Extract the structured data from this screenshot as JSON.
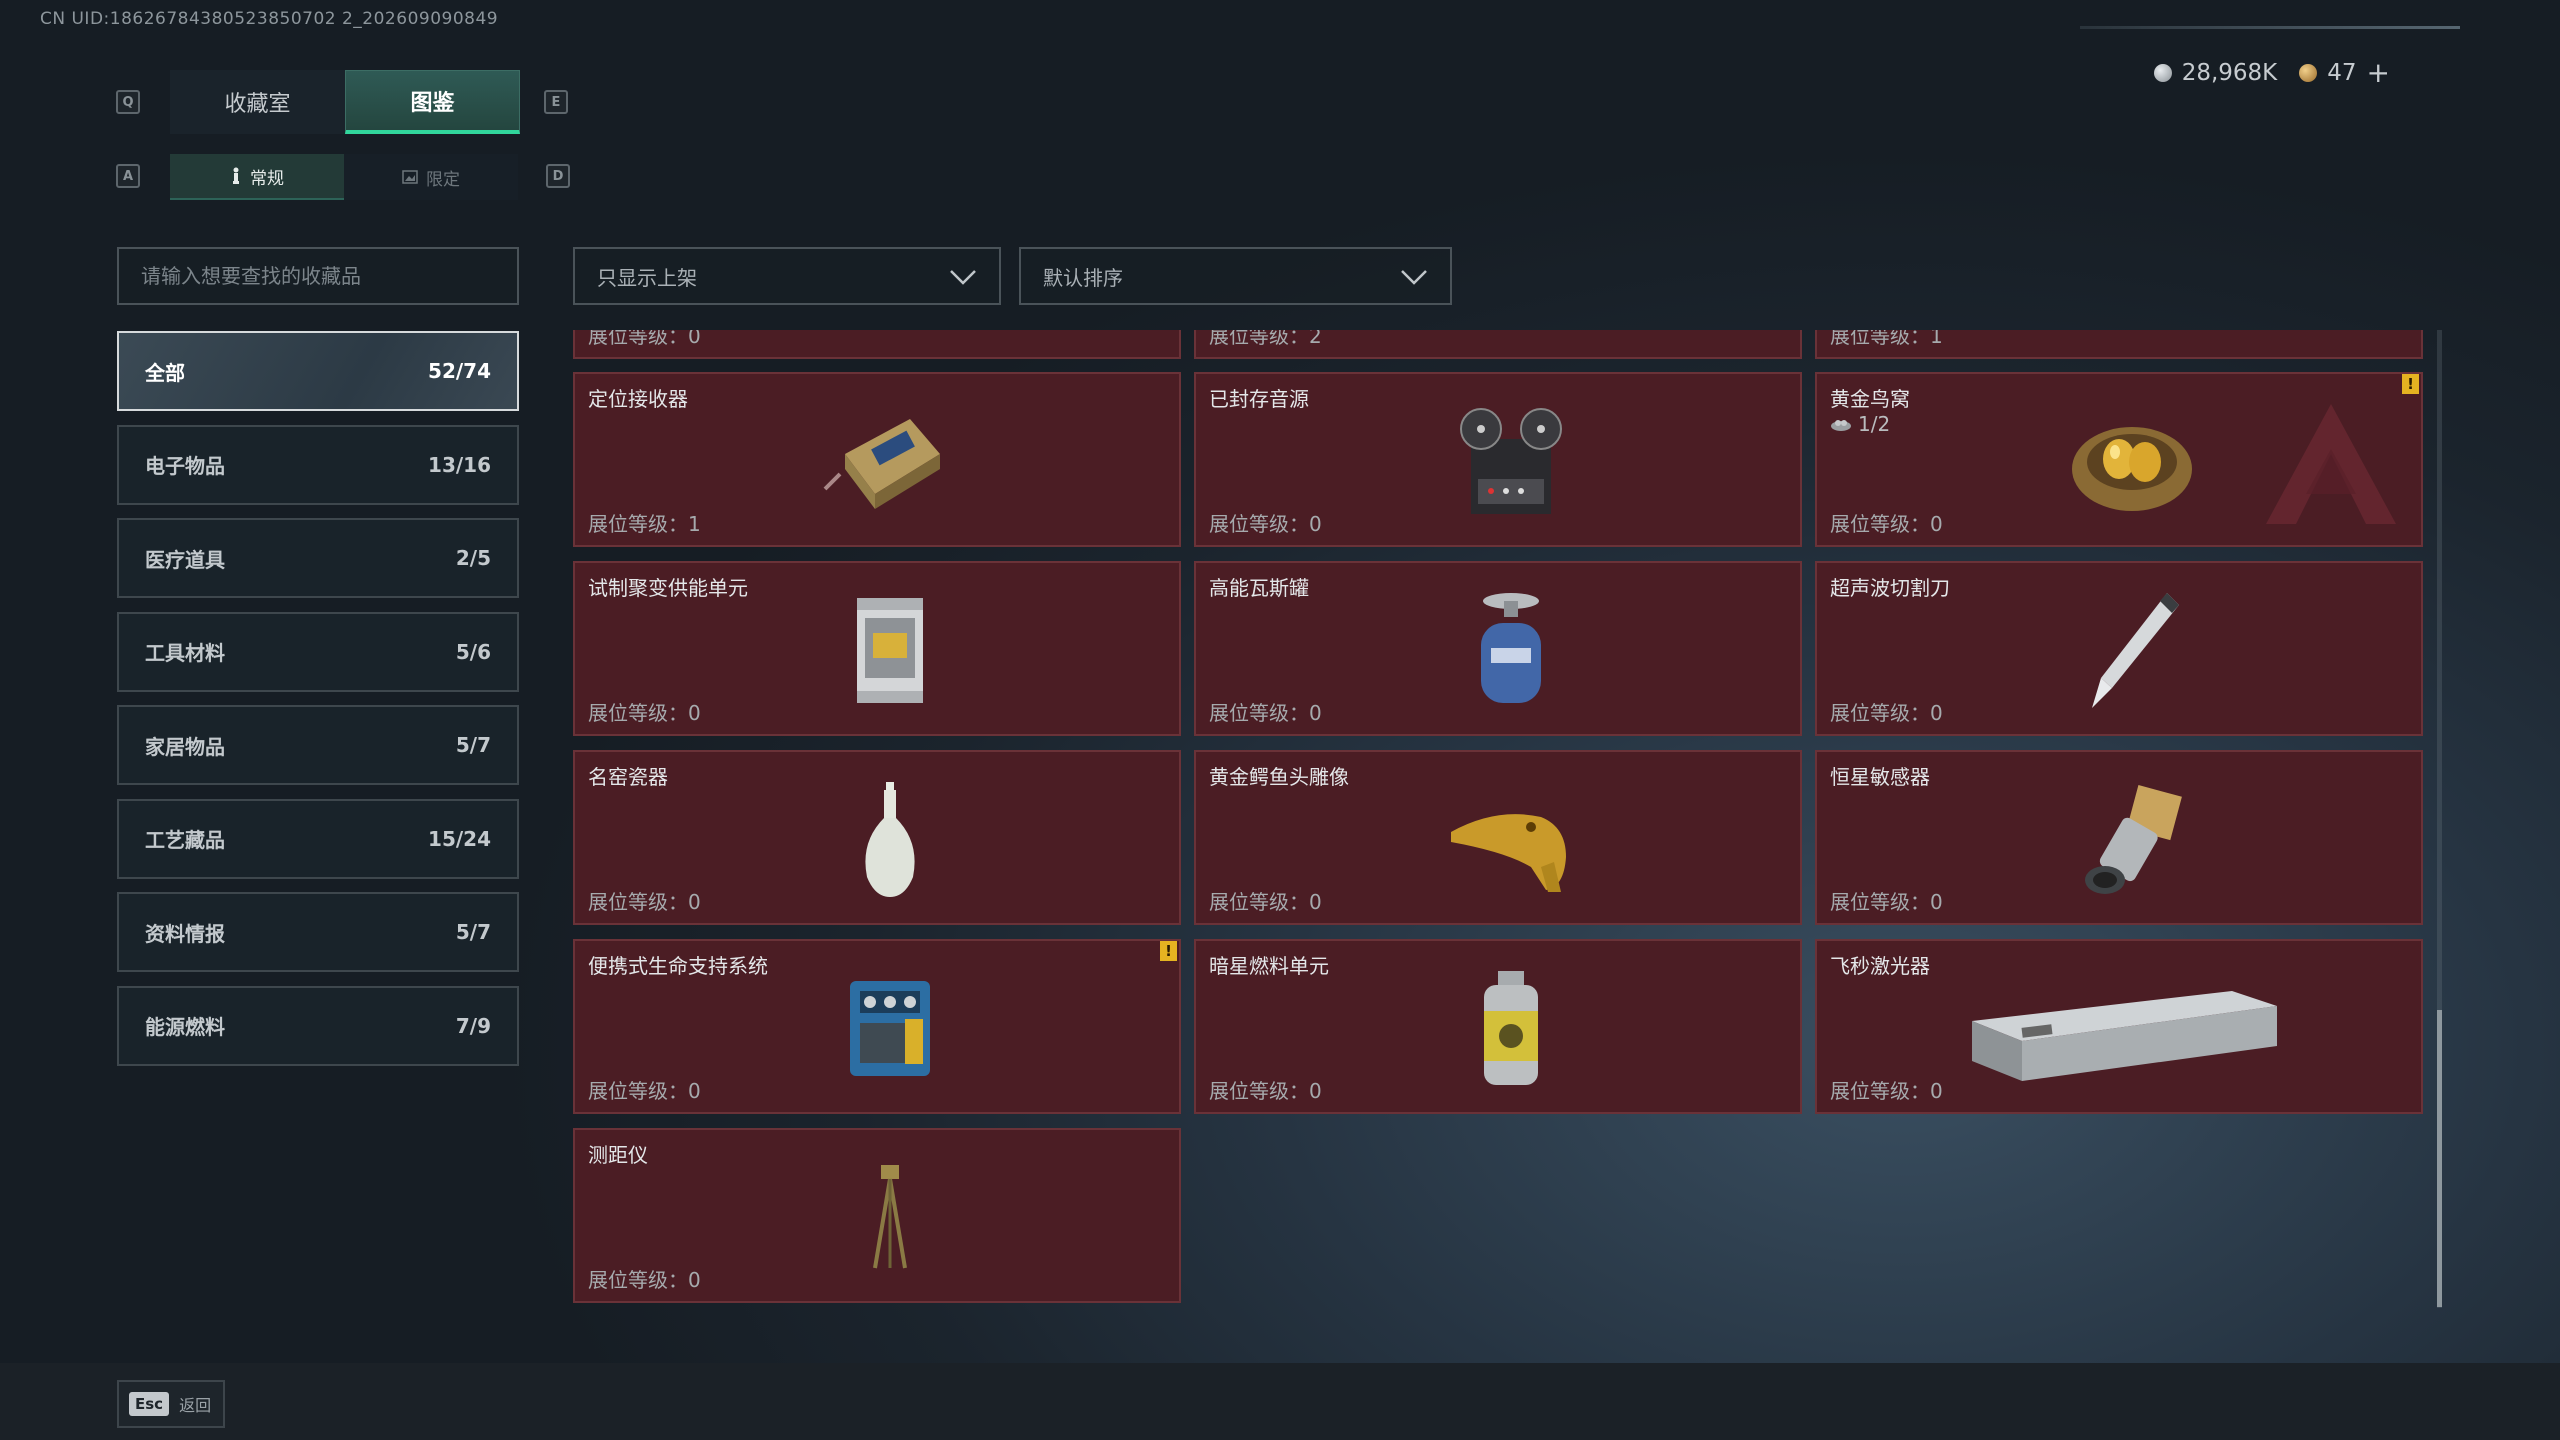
{
  "uid": "CN UID:18626784380523850702 2_202609090849",
  "currency": {
    "silver": "28,968K",
    "gold": "47",
    "plus": "+"
  },
  "keys": {
    "prev_tab": "Q",
    "next_tab": "E",
    "prev_subtab": "A",
    "next_subtab": "D"
  },
  "tabs": [
    {
      "label": "收藏室",
      "active": false
    },
    {
      "label": "图鉴",
      "active": true
    }
  ],
  "subtabs": [
    {
      "label": "常规",
      "icon": "figure-icon",
      "active": true
    },
    {
      "label": "限定",
      "icon": "image-icon",
      "active": false
    }
  ],
  "search": {
    "placeholder": "请输入想要查找的收藏品"
  },
  "filters": {
    "display": "只显示上架",
    "sort": "默认排序"
  },
  "categories": [
    {
      "label": "全部",
      "count": "52/74",
      "active": true
    },
    {
      "label": "电子物品",
      "count": "13/16"
    },
    {
      "label": "医疗道具",
      "count": "2/5"
    },
    {
      "label": "工具材料",
      "count": "5/6"
    },
    {
      "label": "家居物品",
      "count": "5/7"
    },
    {
      "label": "工艺藏品",
      "count": "15/24"
    },
    {
      "label": "资料情报",
      "count": "5/7"
    },
    {
      "label": "能源燃料",
      "count": "7/9"
    }
  ],
  "cards_partial": [
    {
      "level": "展位等级：0"
    },
    {
      "level": "展位等级：2"
    },
    {
      "level": "展位等级：1"
    }
  ],
  "cards": [
    {
      "name": "定位接收器",
      "level": "展位等级：1",
      "icon": "receiver-icon"
    },
    {
      "name": "已封存音源",
      "level": "展位等级：0",
      "icon": "tape-recorder-icon"
    },
    {
      "name": "黄金鸟窝",
      "level": "展位等级：0",
      "count": "1/2",
      "icon": "golden-nest-icon",
      "warning": "!"
    },
    {
      "name": "试制聚变供能单元",
      "level": "展位等级：0",
      "icon": "fusion-unit-icon"
    },
    {
      "name": "高能瓦斯罐",
      "level": "展位等级：0",
      "icon": "gas-canister-icon"
    },
    {
      "name": "超声波切割刀",
      "level": "展位等级：0",
      "icon": "ultrasonic-knife-icon"
    },
    {
      "name": "名窑瓷器",
      "level": "展位等级：0",
      "icon": "porcelain-vase-icon"
    },
    {
      "name": "黄金鳄鱼头雕像",
      "level": "展位等级：0",
      "icon": "gold-crocodile-icon"
    },
    {
      "name": "恒星敏感器",
      "level": "展位等级：0",
      "icon": "star-sensor-icon"
    },
    {
      "name": "便携式生命支持系统",
      "level": "展位等级：0",
      "icon": "life-support-icon",
      "warning": "!"
    },
    {
      "name": "暗星燃料单元",
      "level": "展位等级：0",
      "icon": "fuel-cell-icon"
    },
    {
      "name": "飞秒激光器",
      "level": "展位等级：0",
      "icon": "femtosecond-laser-icon"
    },
    {
      "name": "测距仪",
      "level": "展位等级：0",
      "icon": "rangefinder-icon"
    }
  ],
  "footer": {
    "esc_key": "Esc",
    "back": "返回"
  },
  "colors": {
    "card_bg": "#4b1d24",
    "accent": "#31d69c",
    "warning": "#e5b321"
  }
}
